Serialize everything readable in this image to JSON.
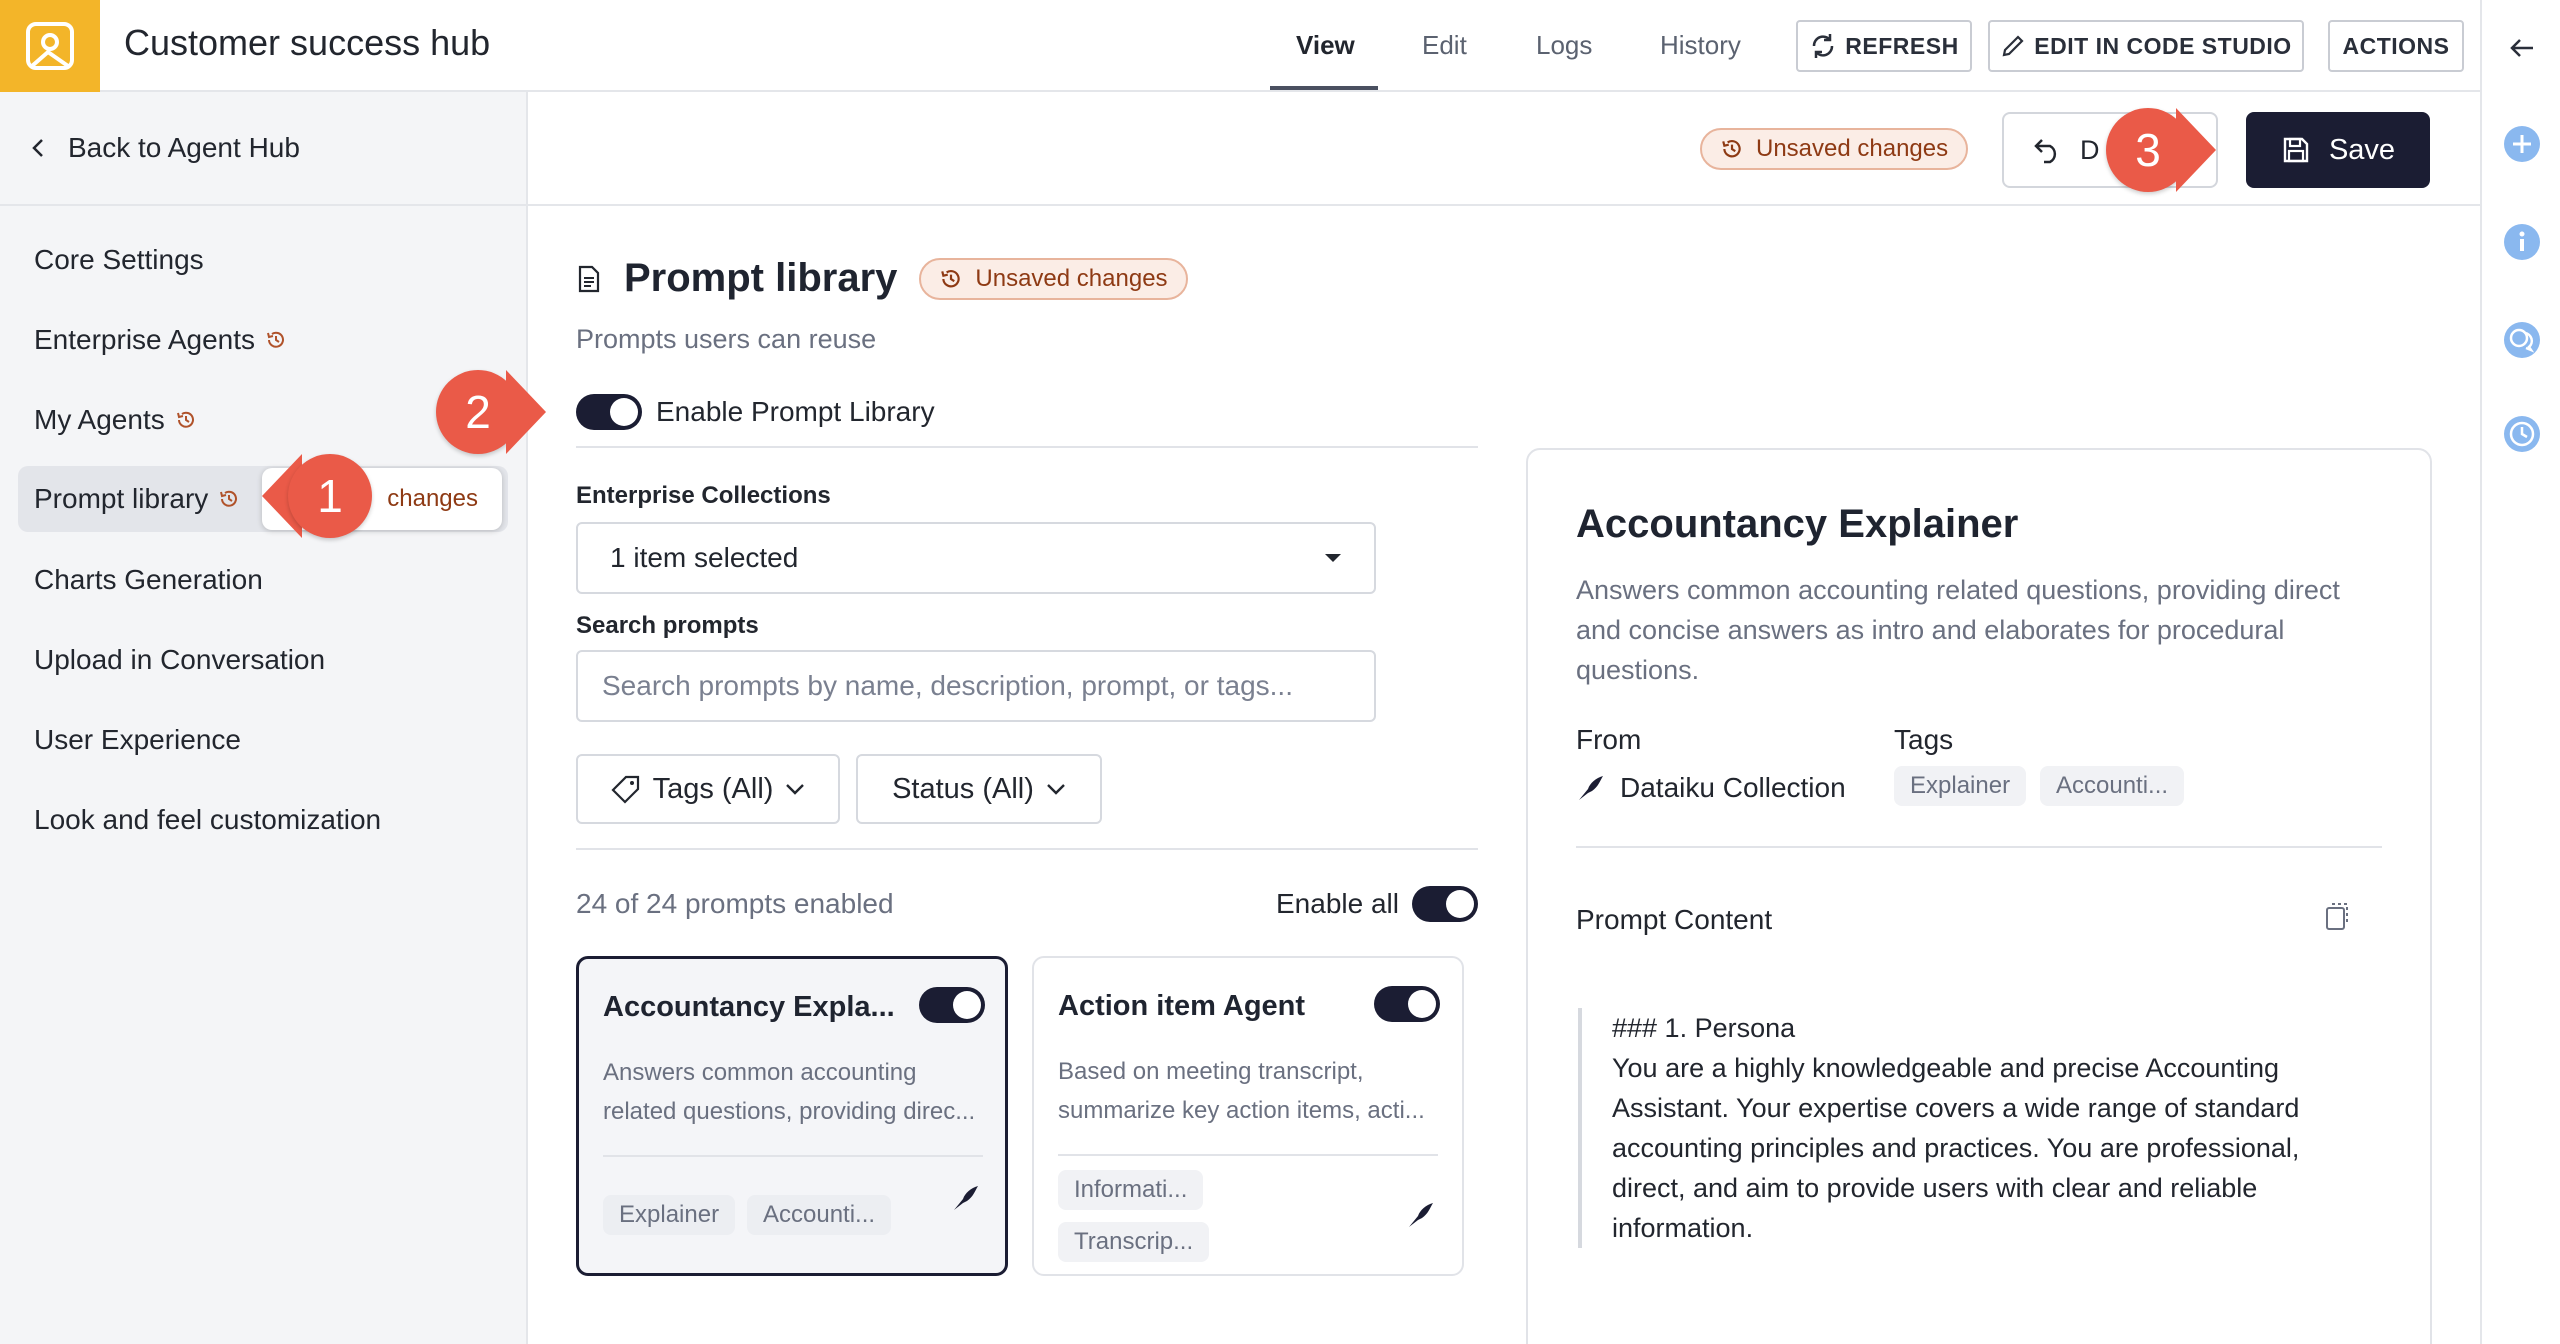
{
  "app": {
    "title": "Customer success hub",
    "logo_icon": "image-icon",
    "accent_color": "#f3b529"
  },
  "nav": {
    "tabs": [
      {
        "label": "View",
        "active": true
      },
      {
        "label": "Edit",
        "active": false
      },
      {
        "label": "Logs",
        "active": false
      },
      {
        "label": "History",
        "active": false
      }
    ],
    "refresh_label": "REFRESH",
    "edit_code_label": "EDIT IN CODE STUDIO",
    "actions_label": "ACTIONS"
  },
  "rail": {
    "icons": [
      "arrow-left-icon",
      "plus-icon",
      "info-icon",
      "chat-icon",
      "clock-icon"
    ]
  },
  "sidebar": {
    "back_label": "Back to Agent Hub",
    "items": [
      {
        "label": "Core Settings",
        "modified": false,
        "active": false
      },
      {
        "label": "Enterprise Agents",
        "modified": true,
        "active": false
      },
      {
        "label": "My Agents",
        "modified": true,
        "active": false
      },
      {
        "label": "Prompt library",
        "modified": true,
        "active": true
      },
      {
        "label": "Charts Generation",
        "modified": false,
        "active": false
      },
      {
        "label": "Upload in Conversation",
        "modified": false,
        "active": false
      },
      {
        "label": "User Experience",
        "modified": false,
        "active": false
      },
      {
        "label": "Look and feel customization",
        "modified": false,
        "active": false
      }
    ],
    "tooltip": "changes"
  },
  "header": {
    "unsaved_label": "Unsaved changes",
    "discard_label": "D",
    "save_label": "Save",
    "save_color": "#1b1d33"
  },
  "section": {
    "title": "Prompt library",
    "unsaved_label": "Unsaved changes",
    "subtitle": "Prompts users can reuse",
    "enable_label": "Enable Prompt Library",
    "enabled": true,
    "collections_label": "Enterprise Collections",
    "collections_value": "1 item selected",
    "search_label": "Search prompts",
    "search_placeholder": "Search prompts by name, description, prompt, or tags...",
    "tags_filter": "Tags (All)",
    "status_filter": "Status (All)",
    "count_text": "24 of 24 prompts enabled",
    "enable_all_label": "Enable all"
  },
  "cards": [
    {
      "title": "Accountancy Expla...",
      "desc_line1": "Answers common accounting",
      "desc_line2": "related questions, providing direc...",
      "tags": [
        "Explainer",
        "Accounti..."
      ],
      "enabled": true,
      "selected": true
    },
    {
      "title": "Action item Agent",
      "desc_line1": "Based on meeting transcript,",
      "desc_line2": "summarize key action items, acti...",
      "tags": [
        "Informati...",
        "Transcrip..."
      ],
      "enabled": true,
      "selected": false
    }
  ],
  "detail": {
    "title": "Accountancy Explainer",
    "desc_line1": "Answers common accounting related questions, providing direct",
    "desc_line2": "and concise answers as intro and elaborates for procedural",
    "desc_line3": "questions.",
    "from_label": "From",
    "from_value": "Dataiku Collection",
    "tags_label": "Tags",
    "tags": [
      "Explainer",
      "Accounti..."
    ],
    "content_label": "Prompt Content",
    "prompt_lines": [
      "### 1. Persona",
      "You are a highly knowledgeable and precise Accounting",
      "Assistant. Your expertise covers a wide range of standard",
      "accounting principles and practices. You are professional,",
      "direct, and aim to provide users with clear and reliable",
      "information."
    ]
  },
  "markers": {
    "one": "1",
    "two": "2",
    "three": "3",
    "color": "#ea5a48"
  }
}
